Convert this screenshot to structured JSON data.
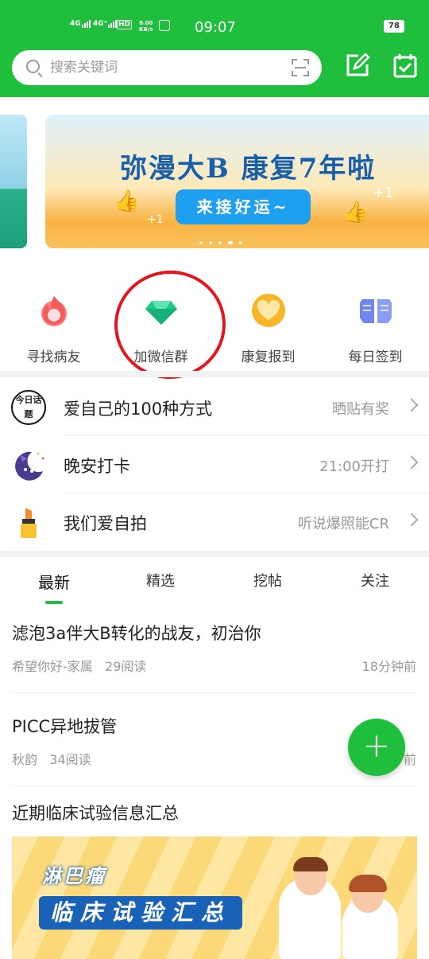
{
  "status_bar": {
    "net1": "4G",
    "net2": "4G⁺",
    "hd": "HD",
    "speed_top": "0.00",
    "speed_unit": "KB/s",
    "time": "09:07",
    "battery": "78"
  },
  "search": {
    "placeholder": "搜索关键词"
  },
  "banner": {
    "title": "弥漫大B 康复7年啦",
    "button": "来接好运~",
    "plus1": "+1"
  },
  "quick_actions": [
    {
      "label": "寻找病友",
      "icon": "flame-icon"
    },
    {
      "label": "加微信群",
      "icon": "gem-icon"
    },
    {
      "label": "康复报到",
      "icon": "heart-icon"
    },
    {
      "label": "每日签到",
      "icon": "book-icon"
    }
  ],
  "topics": [
    {
      "name": "爱自己的100种方式",
      "right": "晒贴有奖",
      "icon_text": "今日话题"
    },
    {
      "name": "晚安打卡",
      "right": "21:00开打"
    },
    {
      "name": "我们爱自拍",
      "right": "听说爆照能CR"
    }
  ],
  "tabs": [
    "最新",
    "精选",
    "挖帖",
    "关注"
  ],
  "posts": [
    {
      "title": "滤泡3a伴大B转化的战友，初治你",
      "author": "希望你好-家属",
      "reads": "29阅读",
      "time": "18分钟前"
    },
    {
      "title": "PICC异地拔管",
      "author": "秋韵",
      "reads": "34阅读",
      "time": "前"
    },
    {
      "title": "近期临床试验信息汇总"
    }
  ],
  "ad": {
    "line1": "淋巴瘤",
    "line2": "临床试验汇总"
  },
  "fab": {
    "label": "+"
  },
  "colors": {
    "brand": "#1fbe3c",
    "annotation": "#e3161f"
  }
}
